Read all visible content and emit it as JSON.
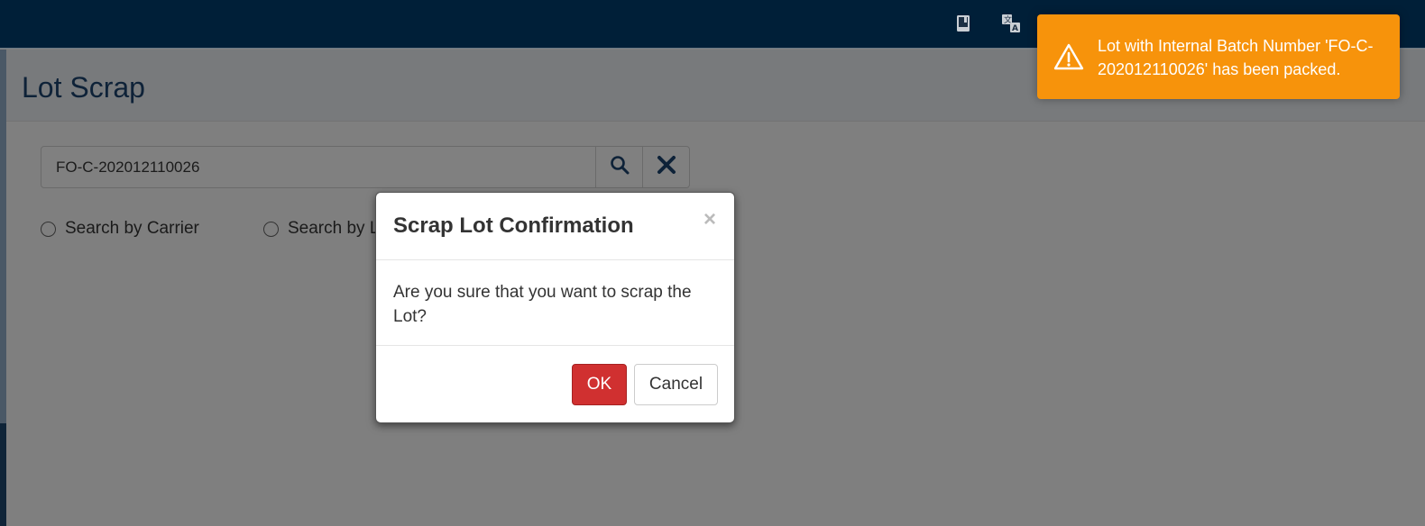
{
  "navbar": {
    "icons": [
      "book-icon",
      "translate-icon"
    ]
  },
  "page": {
    "title": "Lot Scrap",
    "search": {
      "value": "FO-C-202012110026"
    },
    "radios": {
      "carrier_label": "Search by Carrier",
      "lot_label": "Search by L"
    }
  },
  "modal": {
    "title": "Scrap Lot Confirmation",
    "close": "×",
    "body": "Are you sure that you want to scrap the Lot?",
    "ok_label": "OK",
    "cancel_label": "Cancel"
  },
  "toast": {
    "message": "Lot with Internal Batch Number 'FO-C-202012110026' has been packed.",
    "color": "#f7930b",
    "icon": "warning-icon"
  }
}
